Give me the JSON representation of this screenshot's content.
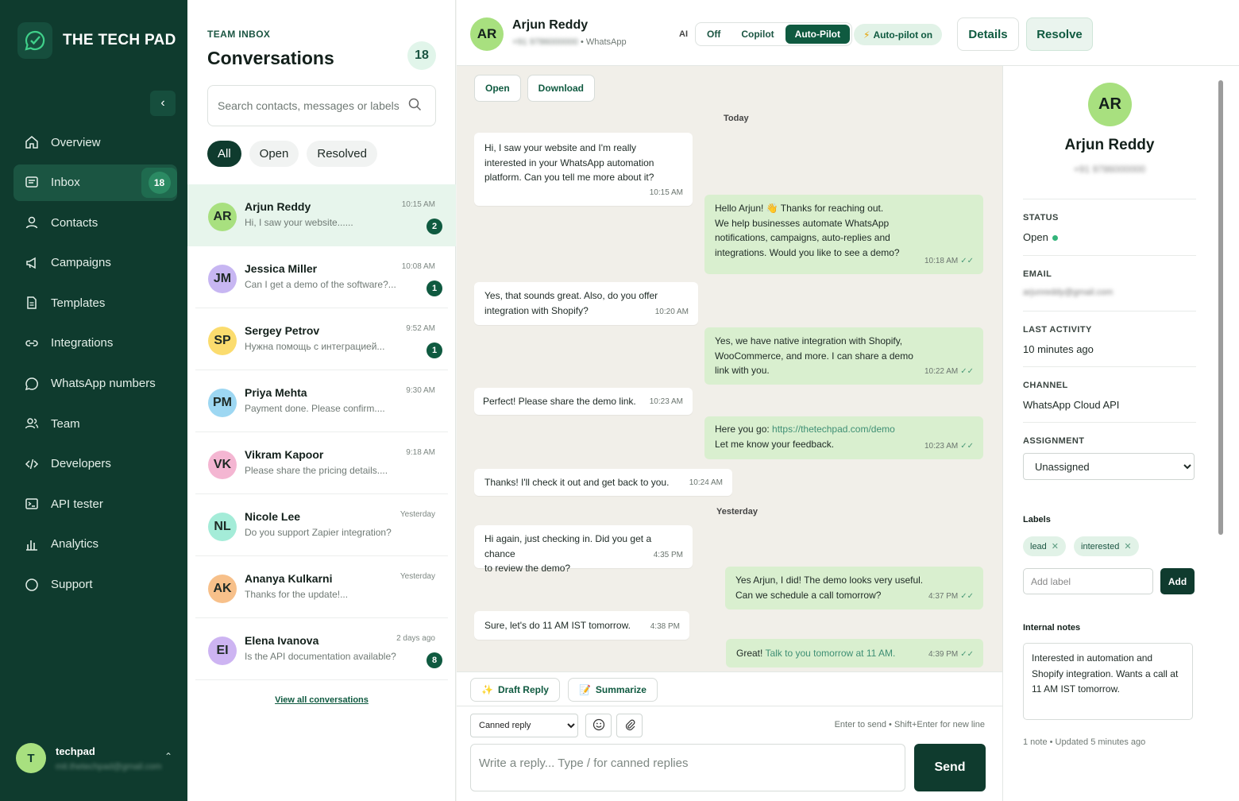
{
  "brand": {
    "name": "THE TECH PAD"
  },
  "nav": {
    "items": [
      {
        "label": "Overview",
        "icon": "home-icon"
      },
      {
        "label": "Inbox",
        "icon": "inbox-icon",
        "badge": "18"
      },
      {
        "label": "Contacts",
        "icon": "user-icon"
      },
      {
        "label": "Campaigns",
        "icon": "megaphone-icon"
      },
      {
        "label": "Templates",
        "icon": "document-icon"
      },
      {
        "label": "Integrations",
        "icon": "link-icon"
      },
      {
        "label": "WhatsApp numbers",
        "icon": "whatsapp-icon"
      },
      {
        "label": "Team",
        "icon": "team-icon"
      },
      {
        "label": "Developers",
        "icon": "code-icon"
      },
      {
        "label": "API tester",
        "icon": "terminal-icon"
      },
      {
        "label": "Analytics",
        "icon": "chart-icon"
      },
      {
        "label": "Support",
        "icon": "circle-icon"
      }
    ]
  },
  "user": {
    "initial": "T",
    "name": "techpad",
    "email": "mit.thetechpad@gmail.com"
  },
  "inbox": {
    "eyebrow": "TEAM INBOX",
    "title": "Conversations",
    "count": "18",
    "search_placeholder": "Search contacts, messages or labels",
    "filters": [
      "All",
      "Open",
      "Resolved"
    ],
    "conversations": [
      {
        "initials": "AR",
        "name": "Arjun Reddy",
        "preview": "Hi, I saw your website......",
        "time": "10:15 AM",
        "unread": "2",
        "color": "#a8e07f"
      },
      {
        "initials": "JM",
        "name": "Jessica Miller",
        "preview": "Can I get a demo of the software?...",
        "time": "10:08 AM",
        "unread": "1",
        "color": "#c7b6f2"
      },
      {
        "initials": "SP",
        "name": "Sergey Petrov",
        "preview": "Нужна помощь с интеграцией...",
        "time": "9:52 AM",
        "unread": "1",
        "color": "#fbdc6e"
      },
      {
        "initials": "PM",
        "name": "Priya Mehta",
        "preview": "Payment done. Please confirm....",
        "time": "9:30 AM",
        "unread": "",
        "color": "#9dd7f2"
      },
      {
        "initials": "VK",
        "name": "Vikram Kapoor",
        "preview": "Please share the pricing details....",
        "time": "9:18 AM",
        "unread": "",
        "color": "#f4b6d2"
      },
      {
        "initials": "NL",
        "name": "Nicole Lee",
        "preview": "Do you support Zapier integration?",
        "time": "Yesterday",
        "unread": "",
        "color": "#a4ecd8"
      },
      {
        "initials": "AK",
        "name": "Ananya Kulkarni",
        "preview": "Thanks for the update!...",
        "time": "Yesterday",
        "unread": "",
        "color": "#f7c08a"
      },
      {
        "initials": "EI",
        "name": "Elena Ivanova",
        "preview": "Is the API documentation available?",
        "time": "2 days ago",
        "unread": "8",
        "color": "#cdb4f2"
      }
    ],
    "view_all": "View all conversations"
  },
  "header": {
    "initials": "AR",
    "name": "Arjun Reddy",
    "phone": "+91 9786000000",
    "channel": "• WhatsApp",
    "ai_label": "AI",
    "ai_options": [
      "Off",
      "Copilot",
      "Auto-Pilot"
    ],
    "ai_selected": "Auto-Pilot",
    "autopilot_badge": "Auto-pilot on",
    "details_btn": "Details",
    "resolve_btn": "Resolve"
  },
  "chat": {
    "top_buttons": [
      "Open",
      "Download"
    ],
    "day_today": "Today",
    "day_yesterday": "Yesterday",
    "messages": [
      {
        "dir": "in",
        "lines": [
          "Hi, I saw your website and I'm really",
          "interested in your WhatsApp automation",
          "platform. Can you tell me more about it?"
        ],
        "time": "10:15 AM"
      },
      {
        "dir": "out",
        "lines": [
          "Hello Arjun! 👋  Thanks for reaching out.",
          "We help businesses automate WhatsApp",
          "notifications, campaigns, auto-replies and",
          "integrations. Would you like to see a demo?"
        ],
        "time": "10:18 AM"
      },
      {
        "dir": "in",
        "lines": [
          "Yes, that sounds great. Also, do you offer",
          "integration with Shopify?"
        ],
        "time": "10:20 AM"
      },
      {
        "dir": "out",
        "lines": [
          "Yes, we have native integration with Shopify,",
          "WooCommerce, and more. I can share a demo",
          "link with you."
        ],
        "time": "10:22 AM"
      },
      {
        "dir": "in",
        "lines": [
          "Perfect! Please share the demo link."
        ],
        "time": "10:23 AM"
      },
      {
        "dir": "out",
        "prefix": "Here you go: ",
        "link": "https://thetechpad.com/demo",
        "lines2": [
          "Let me know your feedback."
        ],
        "time": "10:23 AM"
      },
      {
        "dir": "in",
        "lines": [
          "Thanks! I'll check it out and get back to you."
        ],
        "time": "10:24 AM"
      },
      {
        "dir": "in",
        "lines": [
          "Hi again, just checking in. Did you get a chance",
          "to review the demo?"
        ],
        "time": "4:35 PM"
      },
      {
        "dir": "out",
        "lines": [
          "Yes Arjun, I did! The demo looks very useful.",
          "Can we schedule a call tomorrow?"
        ],
        "time": "4:37 PM"
      },
      {
        "dir": "in",
        "lines": [
          "Sure, let's do 11 AM IST tomorrow."
        ],
        "time": "4:38 PM"
      },
      {
        "dir": "out",
        "prefix": "Great! ",
        "link": "Talk to you tomorrow at 11 AM.",
        "time": "4:39 PM"
      }
    ]
  },
  "composer": {
    "draft_reply": "Draft Reply",
    "summarize": "Summarize",
    "canned_selected": "Canned reply",
    "hint": "Enter to send • Shift+Enter for new line",
    "placeholder": "Write a reply... Type / for canned replies",
    "send": "Send"
  },
  "details": {
    "initials": "AR",
    "name": "Arjun Reddy",
    "phone": "+91 9786000000",
    "status_label": "STATUS",
    "status_value": "Open",
    "email_label": "EMAIL",
    "email_value": "arjunreddy@gmail.com",
    "activity_label": "LAST ACTIVITY",
    "activity_value": "10 minutes ago",
    "channel_label": "CHANNEL",
    "channel_value": "WhatsApp Cloud API",
    "assignment_label": "ASSIGNMENT",
    "assignment_value": "Unassigned",
    "labels_title": "Labels",
    "labels": [
      "lead",
      "interested"
    ],
    "add_label_placeholder": "Add label",
    "add_btn": "Add",
    "notes_title": "Internal notes",
    "notes_text": "Interested in automation and Shopify integration. Wants a call at 11 AM IST tomorrow.",
    "notes_meta": "1 note • Updated 5 minutes ago"
  },
  "colors": {
    "sidebar": "#0f3b2e",
    "accent": "#0f5a40",
    "bubble_out": "#d9efcf",
    "chat_bg": "#f1efe9"
  }
}
